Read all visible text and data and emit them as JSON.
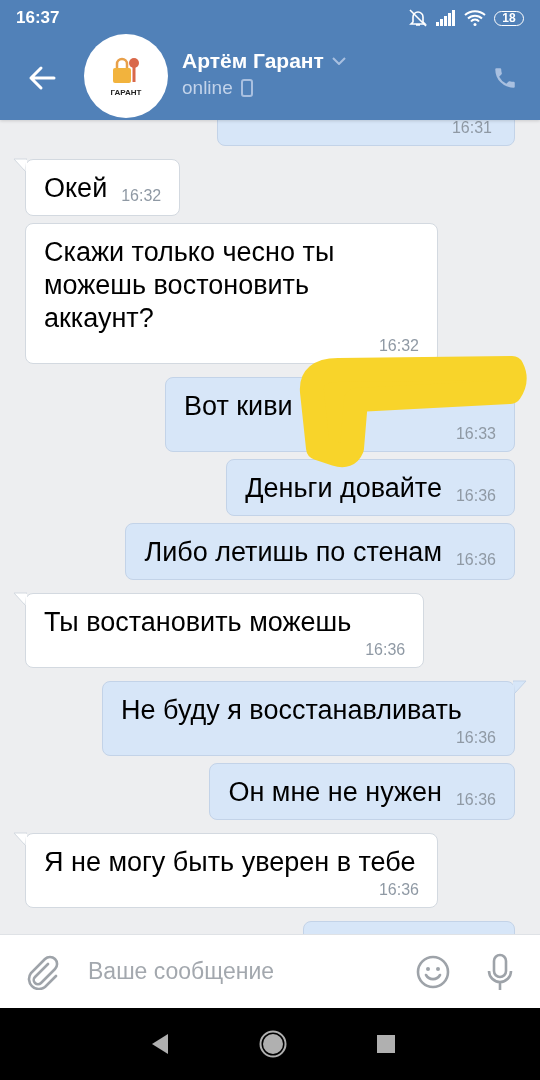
{
  "status_bar": {
    "time": "16:37",
    "battery": "18"
  },
  "header": {
    "name": "Артём Гарант",
    "avatar_label": "ГАРАНТ",
    "status": "online"
  },
  "messages": [
    {
      "kind": "cut",
      "outgoing": true,
      "tail": false,
      "time": "16:31"
    },
    {
      "kind": "short",
      "outgoing": false,
      "tail": true,
      "text": "Окей",
      "time": "16:32"
    },
    {
      "kind": "long",
      "outgoing": false,
      "tail": false,
      "text": "Скажи только чесно ты можешь востоновить аккаунт?",
      "time": "16:32"
    },
    {
      "kind": "long",
      "outgoing": true,
      "tail": false,
      "text": "Вот киви",
      "time": "16:33"
    },
    {
      "kind": "short",
      "outgoing": true,
      "tail": false,
      "text": "Деньги довайте",
      "time": "16:36"
    },
    {
      "kind": "short",
      "outgoing": true,
      "tail": false,
      "text": "Либо летишь по стенам",
      "time": "16:36"
    },
    {
      "kind": "long",
      "outgoing": false,
      "tail": true,
      "text": "Ты востановить можешь",
      "time": "16:36"
    },
    {
      "kind": "long",
      "outgoing": true,
      "tail": true,
      "text": "Не буду я восстанавливать",
      "time": "16:36"
    },
    {
      "kind": "short",
      "outgoing": true,
      "tail": false,
      "text": "Он мне не нужен",
      "time": "16:36"
    },
    {
      "kind": "long",
      "outgoing": false,
      "tail": true,
      "text": "Я не могу быть уверен в тебе",
      "time": "16:36"
    },
    {
      "kind": "edge",
      "outgoing": true,
      "tail": false
    }
  ],
  "composer": {
    "placeholder": "Ваше сообщение"
  }
}
